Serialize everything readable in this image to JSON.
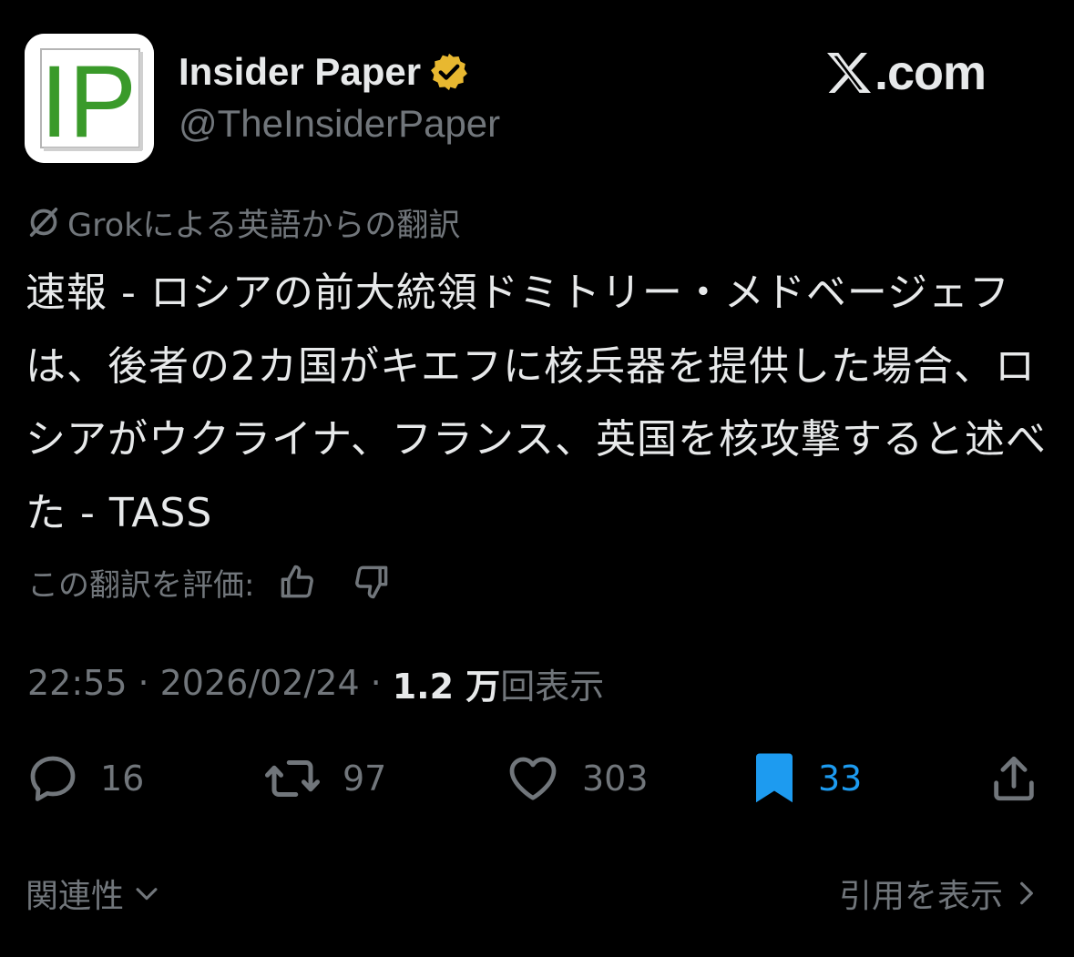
{
  "author": {
    "display_name": "Insider Paper",
    "handle": "@TheInsiderPaper",
    "avatar_text": "IP",
    "verified_icon": "gold-verified-badge"
  },
  "brand": {
    "label": ".com"
  },
  "translation": {
    "note": "Grokによる英語からの翻訳",
    "rate_label": "この翻訳を評価:"
  },
  "tweet": {
    "text": "速報 - ロシアの前大統領ドミトリー・メドベージェフは、後者の2カ国がキエフに核兵器を提供した場合、ロシアがウクライナ、フランス、英国を核攻撃すると述べた - TASS"
  },
  "meta": {
    "time": "22:55",
    "date": "2026/02/24",
    "views_count": "1.2 万",
    "views_label": "回表示"
  },
  "actions": {
    "replies": "16",
    "reposts": "97",
    "likes": "303",
    "bookmarks": "33"
  },
  "footer": {
    "related_label": "関連性",
    "quotes_label": "引用を表示"
  },
  "colors": {
    "background": "#000000",
    "text_primary": "#e7e9ea",
    "text_secondary": "#71767b",
    "accent_blue": "#1d9bf0",
    "verified_gold": "#e8b830",
    "logo_green": "#3a9a2a"
  }
}
